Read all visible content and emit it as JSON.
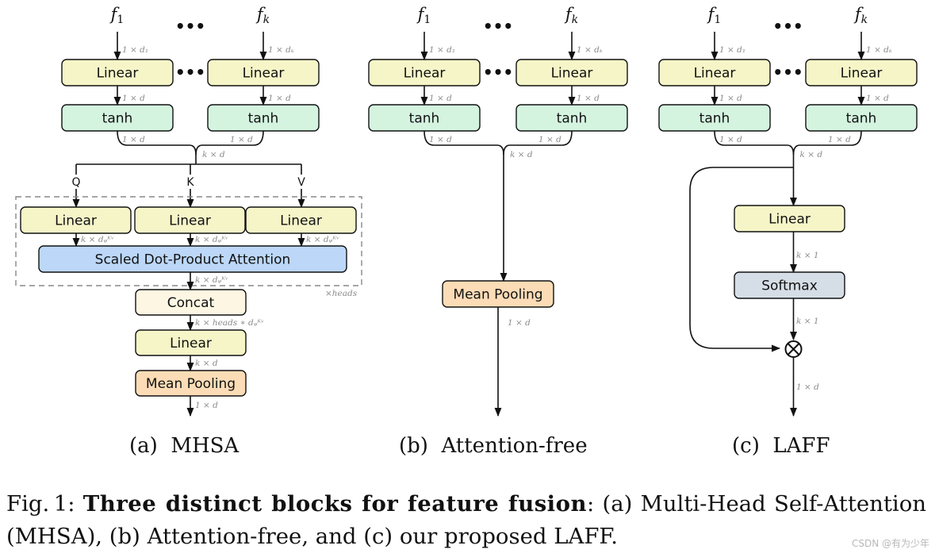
{
  "colors": {
    "linear_fill": "#f5f5c8",
    "tanh_fill": "#d4f4e0",
    "attention_fill": "#bcd7f8",
    "concat_fill": "#fdf6e3",
    "pooling_fill": "#fbdcb6",
    "softmax_fill": "#d5dee6",
    "stroke": "#111111",
    "dim_text": "#8a8a8a",
    "dashed_border": "#888888"
  },
  "inputs": {
    "first": "f",
    "first_sub": "1",
    "last": "f",
    "last_sub": "k",
    "ellipsis": "•••"
  },
  "dims": {
    "in_first": "1 × d₁",
    "in_last": "1 × dₖ",
    "one_by_d": "1 × d",
    "k_by_d": "k × d",
    "k_by_dqkv": "k × dᵩᴷᵛ",
    "k_heads_dqkv": "k × heads ∗ dᵩᴷᵛ",
    "k_by_1": "k × 1",
    "heads_repeat": "×heads"
  },
  "labels": {
    "linear": "Linear",
    "tanh": "tanh",
    "q": "Q",
    "k": "K",
    "v": "V",
    "attention": "Scaled Dot-Product Attention",
    "concat": "Concat",
    "mean_pooling": "Mean Pooling",
    "softmax": "Softmax",
    "multiply": "⊗"
  },
  "panels": [
    {
      "id": "a",
      "caption": "(a)  MHSA"
    },
    {
      "id": "b",
      "caption": "(b)  Attention-free"
    },
    {
      "id": "c",
      "caption": "(c)  LAFF"
    }
  ],
  "caption": {
    "prefix": "Fig. 1: ",
    "bold": "Three distinct blocks for feature fusion",
    "rest": ": (a) Multi-Head Self-Attention (MHSA), (b) Attention-free, and (c) our proposed LAFF."
  },
  "watermark": "CSDN @有为少年"
}
